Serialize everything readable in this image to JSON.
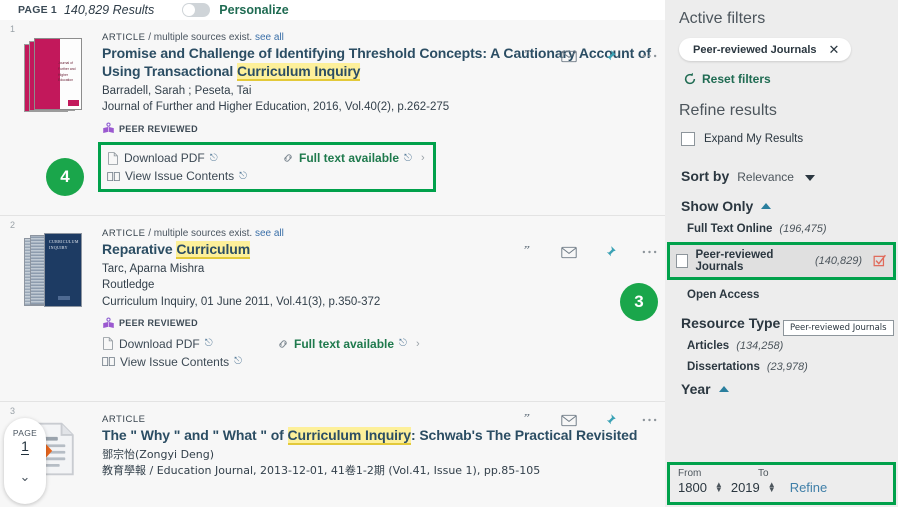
{
  "topbar": {
    "page_label": "PAGE 1",
    "results_count": "140,829 Results",
    "personalize_label": "Personalize",
    "toggle_state": "off"
  },
  "results": [
    {
      "index": "1",
      "kicker_type": "ARTICLE",
      "kicker_rest": "/ multiple sources exist.",
      "see_all": "see all",
      "title_pre": "Promise and Challenge of Identifying Threshold Concepts: A Cautionary Account of Using Transactional ",
      "title_highlight": "Curriculum Inquiry",
      "title_post": "",
      "authors": "Barradell, Sarah ; Peseta, Tai",
      "publisher": "",
      "source": "Journal of Further and Higher Education, 2016, Vol.40(2), p.262-275",
      "peer_reviewed": "PEER REVIEWED",
      "download_label": "Download PDF",
      "issue_label": "View Issue Contents",
      "fulltext_label": "Full text available",
      "boxed": true
    },
    {
      "index": "2",
      "kicker_type": "ARTICLE",
      "kicker_rest": "/ multiple sources exist.",
      "see_all": "see all",
      "title_pre": "Reparative ",
      "title_highlight": "Curriculum",
      "title_post": "",
      "authors": "Tarc, Aparna Mishra",
      "publisher": "Routledge",
      "source": "Curriculum Inquiry, 01 June 2011, Vol.41(3), p.350-372",
      "peer_reviewed": "PEER REVIEWED",
      "download_label": "Download PDF",
      "issue_label": "View Issue Contents",
      "fulltext_label": "Full text available",
      "boxed": false
    },
    {
      "index": "3",
      "kicker_type": "ARTICLE",
      "kicker_rest": "",
      "see_all": "",
      "title_pre": "The \" Why \"  and \" What \"  of ",
      "title_highlight": "Curriculum Inquiry",
      "title_post": ": Schwab's The Practical Revisited",
      "authors": "鄧宗怡(Zongyi Deng)",
      "publisher": "",
      "source": "教育學報 / Education Journal, 2013-12-01, 41卷1-2期 (Vol.41, Issue 1), pp.85-105",
      "peer_reviewed": "",
      "download_label": "",
      "issue_label": "",
      "fulltext_label": "",
      "boxed": false
    }
  ],
  "callouts": {
    "four": "4",
    "three": "3"
  },
  "page_nav": {
    "label": "PAGE",
    "number": "1",
    "chevron": "chevron-down"
  },
  "panel": {
    "active_filters_title": "Active filters",
    "active_chip": "Peer-reviewed Journals",
    "reset_label": "Reset filters",
    "refine_title": "Refine results",
    "expand_label": "Expand My Results",
    "sort_by_label": "Sort by",
    "sort_by_value": "Relevance",
    "show_only": {
      "title": "Show Only",
      "items": [
        {
          "name": "Full Text Online",
          "count": "(196,475)"
        },
        {
          "name": "Peer-reviewed Journals",
          "count": "(140,829)"
        },
        {
          "name": "Open Access",
          "count": ""
        }
      ]
    },
    "resource_type": {
      "title": "Resource Type",
      "items": [
        {
          "name": "Articles",
          "count": "(134,258)"
        },
        {
          "name": "Dissertations",
          "count": "(23,978)"
        }
      ]
    },
    "year": {
      "title": "Year",
      "from_label": "From",
      "to_label": "To",
      "from_value": "1800",
      "to_value": "2019",
      "refine_label": "Refine"
    },
    "tooltip_text": "Peer-reviewed Journals"
  },
  "colors": {
    "green_highlight": "#00a14b",
    "callout_green": "#1aa64b",
    "link_green": "#1f7a4d",
    "title_blue": "#2b4d63",
    "highlight_yellow": "#fdf09a",
    "panel_bg": "#ededed"
  }
}
